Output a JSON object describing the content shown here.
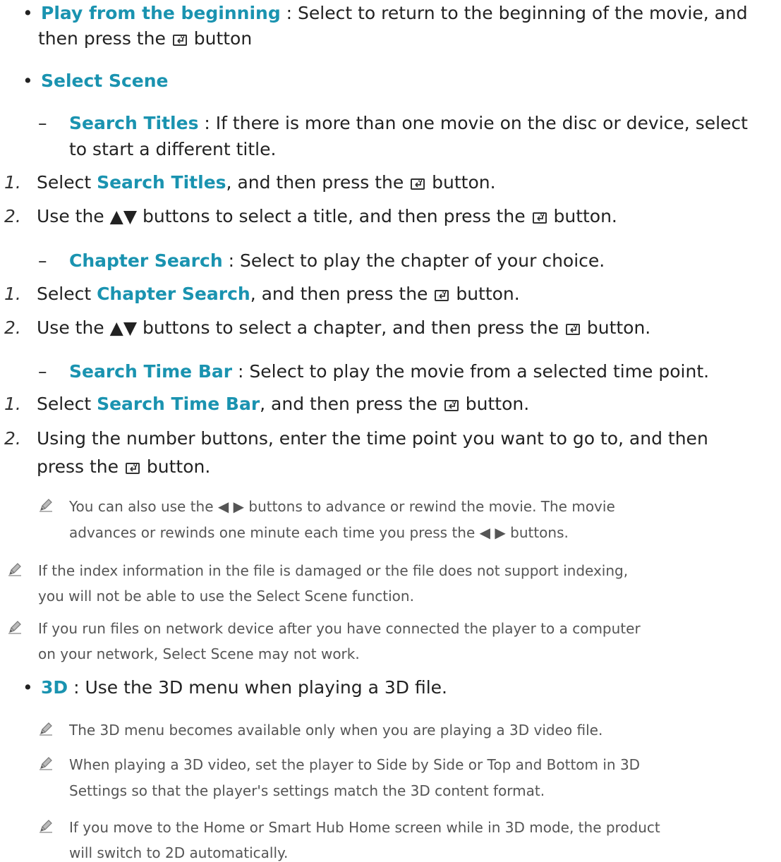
{
  "bullet_char": "•",
  "dash_char": "–",
  "arrows_ud": "▲▼",
  "arrows_lr": "◀ ▶",
  "play_from_beginning": {
    "label": "Play from the beginning",
    "sep": " : ",
    "desc1": "Select to return to the beginning of the movie, and",
    "desc2_pre": "then press the ",
    "desc2_post": " button"
  },
  "select_scene": {
    "label": "Select Scene"
  },
  "search_titles": {
    "label": "Search Titles",
    "sep": " : ",
    "desc1": "If there is more than one movie on the disc or device, select",
    "desc2": "to start a different title.",
    "step1_num": "1.",
    "step1_pre": "Select ",
    "step1_hl": "Search Titles",
    "step1_post": ", and then press the ",
    "step1_end": " button.",
    "step2_num": "2.",
    "step2_pre": "Use the ",
    "step2_mid": " buttons to select a title, and then press the ",
    "step2_end": " button."
  },
  "chapter_search": {
    "label": "Chapter Search",
    "sep": " : ",
    "desc": "Select to play the chapter of your choice.",
    "step1_num": "1.",
    "step1_pre": "Select ",
    "step1_hl": "Chapter Search",
    "step1_post": ", and then press the ",
    "step1_end": " button.",
    "step2_num": "2.",
    "step2_pre": "Use the ",
    "step2_mid": " buttons to select a chapter, and then press the ",
    "step2_end": " button."
  },
  "search_time_bar": {
    "label": "Search Time Bar",
    "sep": " : ",
    "desc": "Select to play the movie from a selected time point.",
    "step1_num": "1.",
    "step1_pre": "Select ",
    "step1_hl": "Search Time Bar",
    "step1_post": ", and then press the ",
    "step1_end": " button.",
    "step2_num": "2.",
    "step2_line1": "Using the number buttons, enter the time point you want to go to, and then",
    "step2_pre": "press the ",
    "step2_end": " button."
  },
  "notes": {
    "advance_line1_pre": "You can also use the ",
    "advance_line1_post": " buttons to advance or rewind the movie. The movie",
    "advance_line2_pre": "advances or rewinds one minute each time you press the ",
    "advance_line2_post": " buttons.",
    "index_line1": "If the index information in the file is damaged or the file does not support indexing,",
    "index_line2": "you will not be able to use the Select Scene function.",
    "network_line1": "If you run files on network device after you have connected the player to a computer",
    "network_line2": "on your network, Select Scene may not work."
  },
  "three_d": {
    "label": "3D",
    "sep": " : ",
    "desc": "Use the 3D menu when playing a 3D file.",
    "note1": "The 3D menu becomes available only when you are playing a 3D video file.",
    "note2_line1": "When playing a 3D video, set the player to Side by Side or Top and Bottom in 3D",
    "note2_line2": "Settings so that the player's settings match the 3D content format.",
    "note3_line1": "If you move to the Home or Smart Hub Home screen while in 3D mode, the product",
    "note3_line2": "will switch to 2D automatically."
  }
}
